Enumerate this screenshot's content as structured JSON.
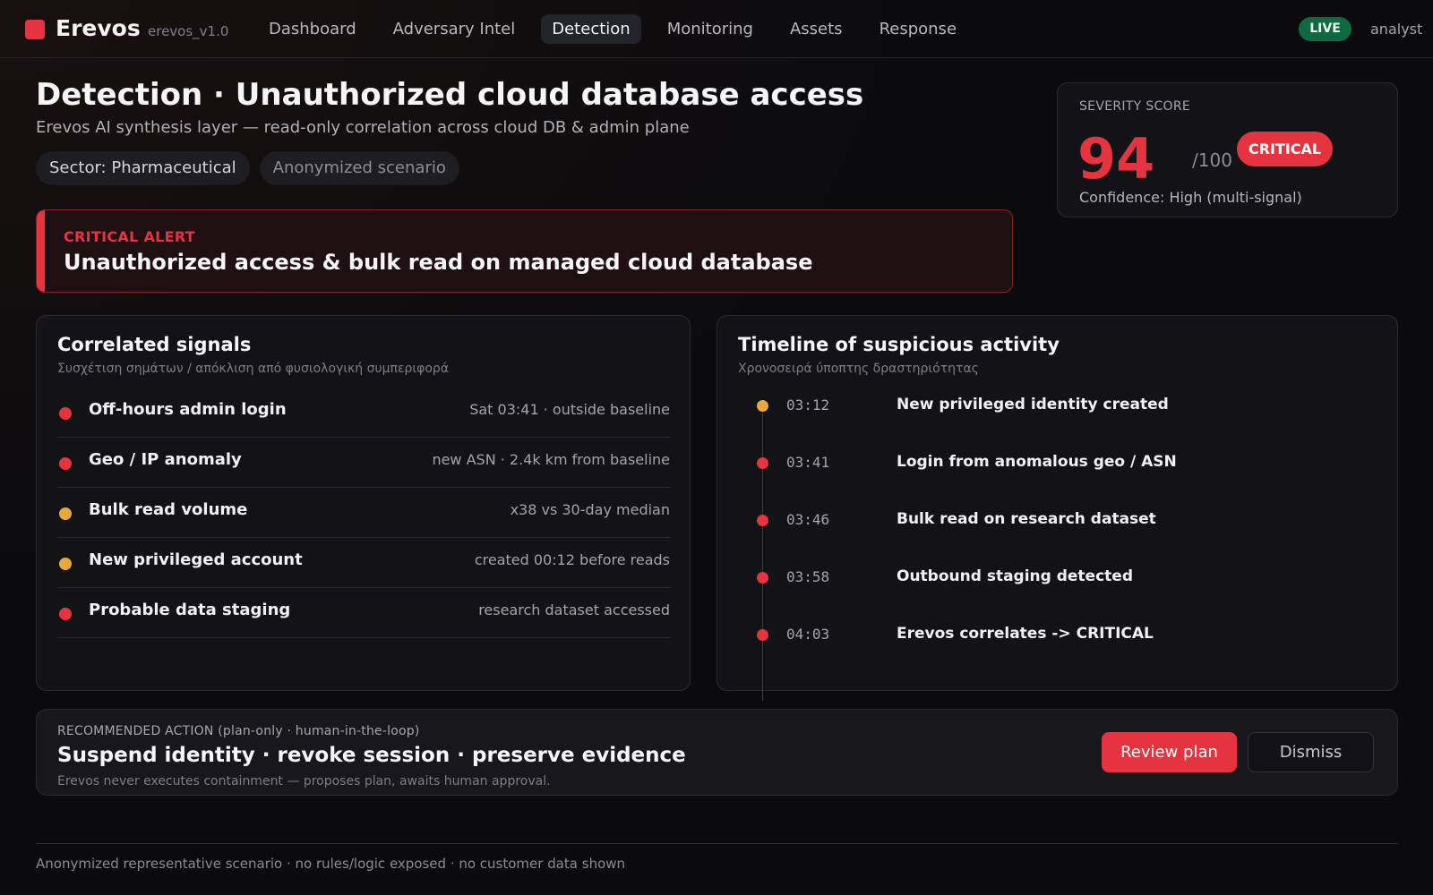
{
  "app": {
    "brand": "Erevos",
    "version": "erevos_v1.0",
    "live_label": "LIVE",
    "user": "analyst",
    "accent_color": "#e5333f"
  },
  "nav": {
    "items": [
      "Dashboard",
      "Adversary Intel",
      "Detection",
      "Monitoring",
      "Assets",
      "Response"
    ],
    "active": "Detection"
  },
  "header": {
    "title": "Detection · Unauthorized cloud database access",
    "subtitle": "Erevos AI synthesis layer — read-only correlation across cloud DB & admin plane",
    "chips": [
      "Sector: Pharmaceutical",
      "Anonymized scenario"
    ]
  },
  "severity": {
    "label": "SEVERITY SCORE",
    "score": "94",
    "max": "/100",
    "badge": "CRITICAL",
    "confidence": "Confidence: High (multi-signal)"
  },
  "alert": {
    "label": "CRITICAL ALERT",
    "text": "Unauthorized access & bulk read on managed cloud database"
  },
  "signals": {
    "title": "Correlated signals",
    "subtitle": "Συσχέτιση σημάτων / απόκλιση από φυσιολογική συμπεριφορά",
    "items": [
      {
        "name": "Off-hours admin login",
        "detail": "Sat 03:41 · outside baseline",
        "level": "red"
      },
      {
        "name": "Geo / IP anomaly",
        "detail": "new ASN · 2.4k km from baseline",
        "level": "red"
      },
      {
        "name": "Bulk read volume",
        "detail": "x38 vs 30-day median",
        "level": "amber"
      },
      {
        "name": "New privileged account",
        "detail": "created 00:12 before reads",
        "level": "amber"
      },
      {
        "name": "Probable data staging",
        "detail": "research dataset accessed",
        "level": "red"
      }
    ]
  },
  "timeline": {
    "title": "Timeline of suspicious activity",
    "subtitle": "Χρονοσειρά ύποπτης δραστηριότητας",
    "events": [
      {
        "time": "03:12",
        "event": "New privileged identity created",
        "level": "amber"
      },
      {
        "time": "03:41",
        "event": "Login from anomalous geo / ASN",
        "level": "red"
      },
      {
        "time": "03:46",
        "event": "Bulk read on research dataset",
        "level": "red"
      },
      {
        "time": "03:58",
        "event": "Outbound staging detected",
        "level": "red"
      },
      {
        "time": "04:03",
        "event": "Erevos correlates -> CRITICAL",
        "level": "red"
      }
    ]
  },
  "action": {
    "label": "RECOMMENDED ACTION (plan-only · human-in-the-loop)",
    "title": "Suspend identity · revoke session · preserve evidence",
    "note": "Erevos never executes containment — proposes plan, awaits human approval.",
    "primary_button": "Review plan",
    "secondary_button": "Dismiss"
  },
  "footer": {
    "text": "Anonymized representative scenario · no rules/logic exposed · no customer data shown"
  },
  "colors": {
    "red": "#e5333f",
    "amber": "#e8a93a"
  }
}
